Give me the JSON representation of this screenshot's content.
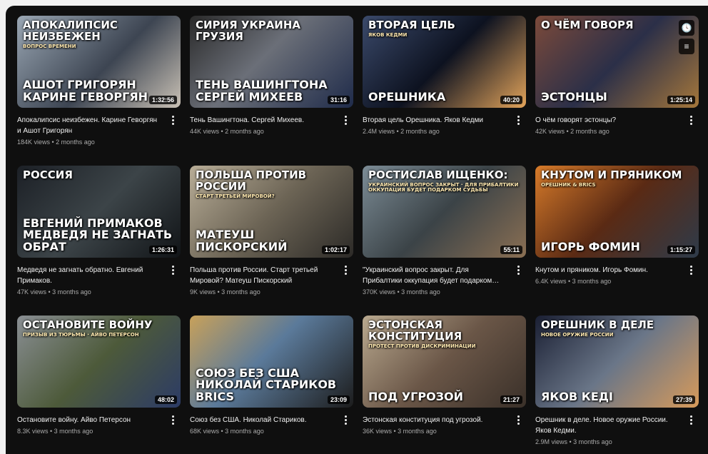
{
  "videos": [
    {
      "thumb_top": "Апокалипсис неизбежен",
      "thumb_sub": "Вопрос времени",
      "thumb_bottom": "Ашот Григорян   Карине Геворгян",
      "duration": "1:32:56",
      "title": "Апокалипсис неизбежен. Карине Геворгян и Ашот Григорян",
      "stats": "184K views • 2 months ago",
      "bg": "linear-gradient(135deg,#9aa7b4 0%,#3d4552 55%,#c9c1b5 100%)"
    },
    {
      "thumb_top": "Сирия Украина Грузия",
      "thumb_sub": "",
      "thumb_bottom": "Тень Вашингтона   Сергей Михеев",
      "duration": "31:16",
      "title": "Тень Вашингтона. Сергей Михеев.",
      "stats": "44K views • 2 months ago",
      "bg": "linear-gradient(135deg,#2a2a2a 0%,#6b6f78 45%,#1f2b4a 100%)"
    },
    {
      "thumb_top": "Вторая цель",
      "thumb_sub": "Яков Кедми",
      "thumb_bottom": "Орешника",
      "duration": "40:20",
      "title": "Вторая цель Орешника. Яков Кедми",
      "stats": "2.4M views • 2 months ago",
      "bg": "linear-gradient(135deg,#3b4a6b 0%,#0d1220 50%,#e2a35a 100%)"
    },
    {
      "thumb_top": "О чём говоря",
      "thumb_sub": "",
      "thumb_bottom": "эстонцы",
      "duration": "1:25:14",
      "title": "О чём говорят эстонцы?",
      "stats": "42K views • 2 months ago",
      "bg": "linear-gradient(135deg,#7c4a3a 0%,#2b2f48 50%,#a5773b 100%)"
    },
    {
      "thumb_top": "Россия",
      "thumb_sub": "",
      "thumb_bottom": "Евгений Примаков   Медведя не загнать обрат",
      "duration": "1:26:31",
      "title": "Медведя не загнать обратно. Евгений Примаков.",
      "stats": "47K views • 3 months ago",
      "bg": "linear-gradient(135deg,#1c2026 0%,#3c4448 50%,#111417 100%)"
    },
    {
      "thumb_top": "Польша против России",
      "thumb_sub": "Старт третьей мировой?",
      "thumb_bottom": "Матеуш Пискорский",
      "duration": "1:02:17",
      "title": "Польша против России. Старт третьей Мировой? Матеуш Пискорский",
      "stats": "9K views • 3 months ago",
      "bg": "linear-gradient(135deg,#b8ad97 0%,#6c6455 50%,#2c2a27 100%)"
    },
    {
      "thumb_top": "Ростислав Ищенко:",
      "thumb_sub": "Украинский вопрос закрыт · Для Прибалтики оккупация будет подарком судьбы",
      "thumb_bottom": "",
      "duration": "55:11",
      "title": "\"Украинский вопрос закрыт. Для Прибалтики оккупация будет подарком…",
      "stats": "370K views • 3 months ago",
      "bg": "linear-gradient(135deg,#7c8c96 0%,#3b4347 50%,#8a6f53 100%)"
    },
    {
      "thumb_top": "Кнутом  и пряником",
      "thumb_sub": "Орешник & BRICS",
      "thumb_bottom": "Игорь Фомин",
      "duration": "1:15:27",
      "title": "Кнутом и пряником. Игорь Фомин.",
      "stats": "6.4K views • 3 months ago",
      "bg": "linear-gradient(135deg,#d77b2a 0%,#5a2a14 50%,#2e3b4a 100%)"
    },
    {
      "thumb_top": "Остановите войну",
      "thumb_sub": "Призыв из тюрьмы · Айво Петерсон",
      "thumb_bottom": "",
      "duration": "48:02",
      "title": "Остановите войну. Айво Петерсон",
      "stats": "8.3K views • 3 months ago",
      "bg": "linear-gradient(135deg,#8a8f94 0%,#4d5a3a 50%,#2c3b66 100%)"
    },
    {
      "thumb_top": "",
      "thumb_sub": "",
      "thumb_bottom": "Союз без США   Николай Стариков   BRICS",
      "duration": "23:09",
      "title": "Союз без США. Николай Стариков.",
      "stats": "68K views • 3 months ago",
      "bg": "linear-gradient(135deg,#c8a15a 0%,#5b7a9a 45%,#1c1c1c 100%)"
    },
    {
      "thumb_top": "Эстонская конституция",
      "thumb_sub": "Протест против дискриминации",
      "thumb_bottom": "под угрозой",
      "duration": "21:27",
      "title": "Эстонская конституция под угрозой.",
      "stats": "36K views • 3 months ago",
      "bg": "linear-gradient(135deg,#b9a98f 0%,#6a5647 50%,#3a3029 100%)"
    },
    {
      "thumb_top": "Орешник в деле",
      "thumb_sub": "Новое оружие России",
      "thumb_bottom": "Яков Кеді",
      "duration": "27:39",
      "title": "Орешник в деле. Новое оружие России. Яков Кедми.",
      "stats": "2.9M views • 3 months ago",
      "bg": "linear-gradient(135deg,#1a1f33 0%,#6a7688 50%,#d79a5a 100%)"
    }
  ]
}
